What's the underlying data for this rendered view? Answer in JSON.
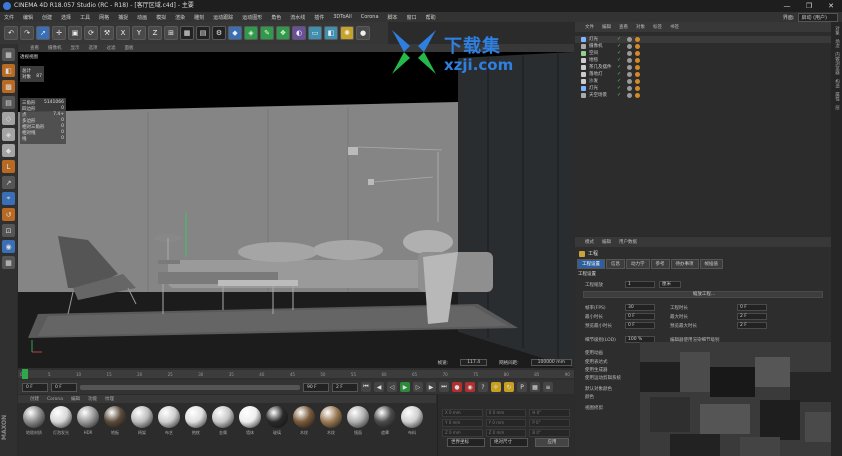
{
  "window": {
    "title": "CINEMA 4D R18.057 Studio (RC - R18) - [客厅区域.c4d] - 主要",
    "controls": [
      "—",
      "❐",
      "✕"
    ]
  },
  "menubar": [
    "文件",
    "编辑",
    "创建",
    "选择",
    "工具",
    "网格",
    "捕捉",
    "动画",
    "模拟",
    "渲染",
    "雕刻",
    "运动跟踪",
    "运动图形",
    "角色",
    "流水线",
    "插件",
    "3DToAll",
    "Corona",
    "脚本",
    "窗口",
    "帮助"
  ],
  "layout": {
    "label": "界面:",
    "value": "启动 (用户)"
  },
  "viewport": {
    "menu": [
      "查看",
      "摄像机",
      "显示",
      "选项",
      "过滤",
      "面板"
    ],
    "label": "透视视图",
    "stats_top": [
      {
        "k": "总计",
        "v": ""
      },
      {
        "k": "对象",
        "v": "87"
      }
    ],
    "stats": [
      {
        "k": "三角形",
        "v": "5141066"
      },
      {
        "k": "四边形",
        "v": "0"
      },
      {
        "k": "点",
        "v": "7.4+"
      },
      {
        "k": "多边形",
        "v": "0"
      },
      {
        "k": "相对三角形",
        "v": "0"
      },
      {
        "k": "相对线",
        "v": "0"
      },
      {
        "k": "线",
        "v": "0"
      }
    ],
    "speed_label": "帧速:",
    "speed_value": "117.4",
    "grid_label": "网格间距:",
    "grid_value": "100000 mm"
  },
  "timeline": {
    "ticks": [
      "0",
      "5",
      "10",
      "15",
      "20",
      "25",
      "30",
      "35",
      "40",
      "45",
      "50",
      "55",
      "60",
      "65",
      "70",
      "75",
      "80",
      "85",
      "90"
    ],
    "frame_marker": "0 F"
  },
  "playback": {
    "start": "0 F",
    "current": "0 F",
    "end": "90 F",
    "end2": "2 F"
  },
  "materials": {
    "menu": [
      "创建",
      "Corona",
      "编辑",
      "功能",
      "纹理"
    ],
    "items": [
      {
        "label": "地毯材质",
        "color": "#8a8a8a"
      },
      {
        "label": "灯泡发光",
        "color": "#d8d8d8"
      },
      {
        "label": "HDR",
        "color": "#9a9a9a"
      },
      {
        "label": "地板",
        "color": "#5a4a3a"
      },
      {
        "label": "椅架",
        "color": "#bdbdbd"
      },
      {
        "label": "布艺",
        "color": "#cfcfcf"
      },
      {
        "label": "抱枕",
        "color": "#e0e0e0"
      },
      {
        "label": "金属",
        "color": "#c8c8c8"
      },
      {
        "label": "墙体",
        "color": "#eeeeee"
      },
      {
        "label": "玻璃",
        "color": "#2a2a2a"
      },
      {
        "label": "木纹",
        "color": "#7a5a3a"
      },
      {
        "label": "木纹",
        "color": "#9a7a55"
      },
      {
        "label": "镜面",
        "color": "#b0b0b0"
      },
      {
        "label": "遮罩",
        "color": "#4a4a4a"
      },
      {
        "label": "布料",
        "color": "#d0d0d0"
      }
    ]
  },
  "coords": {
    "rows": [
      [
        "X 0 mm",
        "X 0 mm",
        "H 0°"
      ],
      [
        "Y 0 mm",
        "Y 0 mm",
        "P 0°"
      ],
      [
        "Z 0 mm",
        "Z 0 mm",
        "B 0°"
      ]
    ],
    "mode1": "世界坐标",
    "mode2": "绝对尺寸",
    "apply": "应用"
  },
  "objects": {
    "menu": [
      "文件",
      "编辑",
      "查看",
      "对象",
      "标签",
      "书签"
    ],
    "items": [
      {
        "name": "灯光",
        "color": "#7fb6ff"
      },
      {
        "name": "摄像机",
        "color": "#aaaaaa"
      },
      {
        "name": "空间",
        "color": "#8fd18f"
      },
      {
        "name": "地毯",
        "color": "#cccccc"
      },
      {
        "name": "茶几及摆件",
        "color": "#cccccc"
      },
      {
        "name": "落地灯",
        "color": "#cccccc"
      },
      {
        "name": "沙发",
        "color": "#cccccc"
      },
      {
        "name": "灯光",
        "color": "#7fb6ff"
      },
      {
        "name": "天空场景",
        "color": "#aaaaaa"
      }
    ]
  },
  "attributes": {
    "header": [
      "模式",
      "编辑",
      "用户数据"
    ],
    "title": "工程",
    "tabs": [
      "工程设置",
      "信息",
      "动力学",
      "参考",
      "待办事项",
      "帧插值"
    ],
    "section": "工程设置",
    "fields": {
      "scale_label": "工程缩放",
      "scale_value": "1",
      "scale_unit": "厘米",
      "scale_btn": "缩放工程...",
      "fps_label": "帧率(FPS)",
      "fps_value": "30",
      "time_label": "工程时长",
      "time_value": "0 F",
      "min_label": "最小时长",
      "min_value": "0 F",
      "max_label": "最大时长",
      "max_value": "2 F",
      "pmin_label": "预览最小时长",
      "pmin_value": "0 F",
      "pmax_label": "预览最大时长",
      "pmax_value": "2 F",
      "lod_label": "细节级别(LOD)",
      "lod_value": "100 %",
      "lod2_label": "编辑器使用渲染细节级别",
      "anim_label": "使用动画",
      "expr_label": "使用表达式",
      "gen_label": "使用生成器",
      "deform_label": "使用变形器",
      "motion_label": "使用运动剪辑系统",
      "obj_color_label": "默认对象颜色",
      "color_label": "颜色",
      "view_label": "视图修剪"
    }
  },
  "right_tabs": [
    "对象",
    "场次",
    "内容浏览器",
    "构造",
    "属性",
    "层"
  ],
  "watermark": {
    "line1": "下载集",
    "line2": "xzji.com"
  },
  "colors": {
    "accent": "#2e5f9c",
    "viewport_bg": "#000000",
    "panel": "#2c2c2c"
  }
}
